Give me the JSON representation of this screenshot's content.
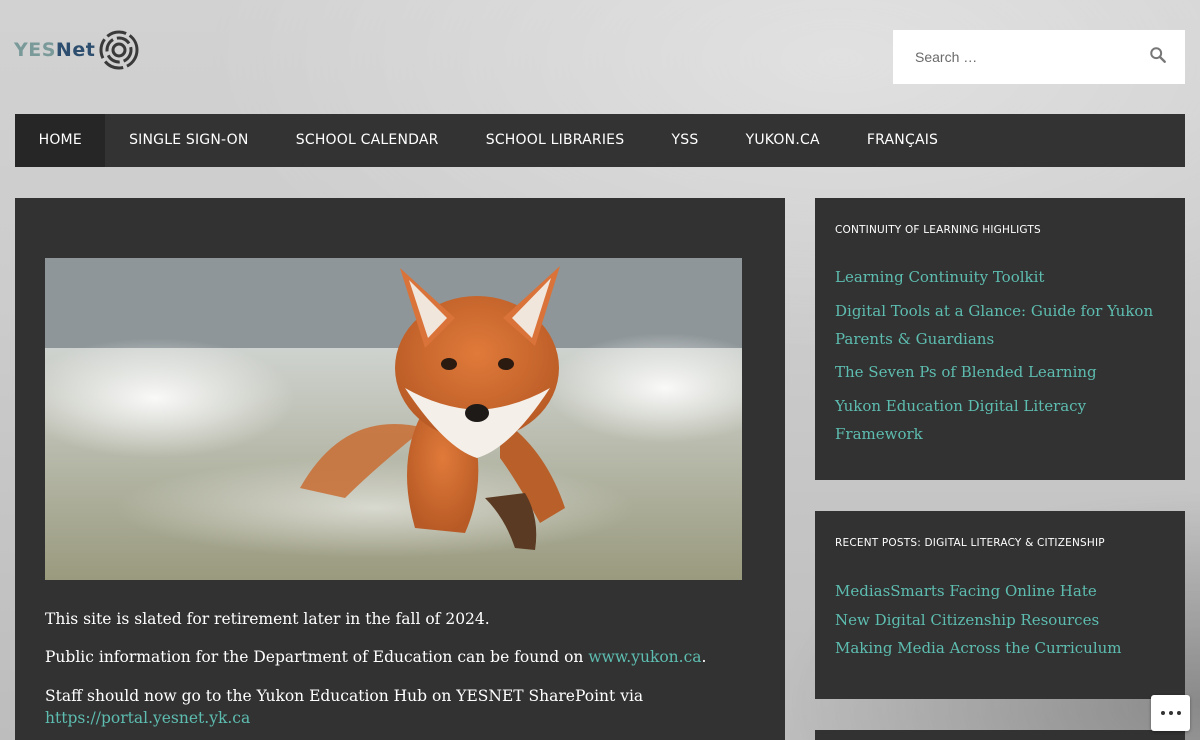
{
  "logo": {
    "part1": "YES",
    "part2": "Net"
  },
  "search": {
    "placeholder": "Search …"
  },
  "nav": {
    "items": [
      {
        "label": "HOME"
      },
      {
        "label": "SINGLE SIGN-ON"
      },
      {
        "label": "SCHOOL CALENDAR"
      },
      {
        "label": "SCHOOL LIBRARIES"
      },
      {
        "label": "YSS"
      },
      {
        "label": "YUKON.CA"
      },
      {
        "label": "FRANÇAIS"
      }
    ]
  },
  "post": {
    "p1": "This site is slated for retirement later in the fall of 2024.",
    "p2_before": "Public information for the Department of Education can be found on ",
    "p2_link": "www.yukon.ca",
    "p2_after": ".",
    "p3": "Staff should now go to the Yukon Education Hub on YESNET SharePoint via",
    "p3_link": "https://portal.yesnet.yk.ca"
  },
  "widget1": {
    "title": "CONTINUITY OF LEARNING HIGHLIGTS",
    "links": [
      {
        "label": "Learning Continuity Toolkit"
      },
      {
        "label": "Digital Tools at a Glance: Guide for Yukon Parents & Guardians"
      },
      {
        "label": "The Seven Ps of Blended Learning"
      },
      {
        "label": "Yukon Education Digital Literacy Framework"
      }
    ]
  },
  "widget2": {
    "title": "RECENT POSTS: DIGITAL LITERACY & CITIZENSHIP",
    "links": [
      {
        "label": "MediasSmarts Facing Online Hate"
      },
      {
        "label": "New Digital Citizenship Resources"
      },
      {
        "label": "Making Media Across the Curriculum"
      }
    ]
  },
  "colors": {
    "accent_link": "#5dbdb0",
    "panel_bg": "#323232",
    "nav_bg": "#333333",
    "logo_yes": "#7a9a9a",
    "logo_net": "#2d4e6e"
  }
}
